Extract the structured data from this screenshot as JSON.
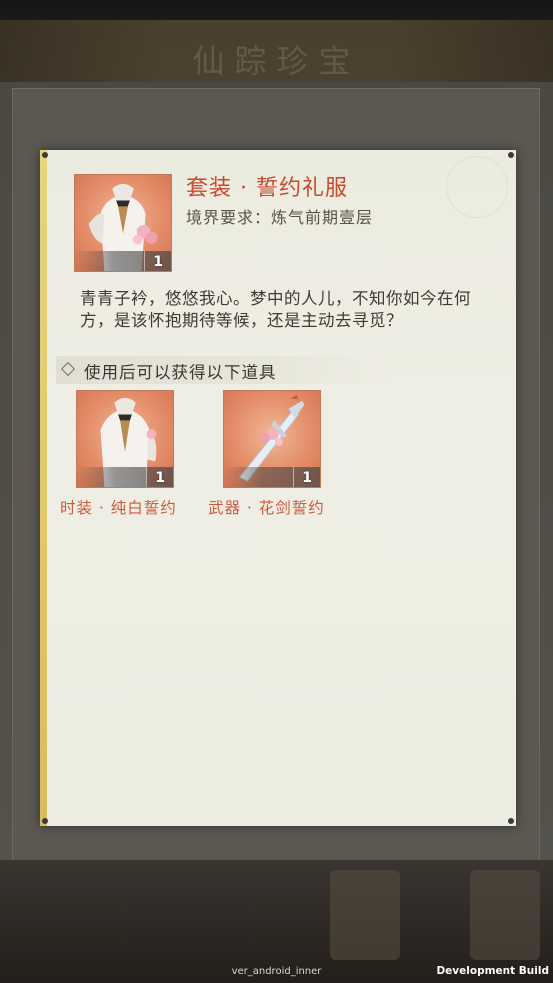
{
  "background": {
    "title": "仙踪珍宝"
  },
  "item": {
    "title": "套装 · 誓约礼服",
    "requirement": "境界要求：炼气前期壹层",
    "count": "1",
    "icon": "white-suit-outfit-icon",
    "description": "青青子衿，悠悠我心。梦中的人儿，不知你如今在何方，是该怀抱期待等候，还是主动去寻觅？"
  },
  "rewards_section": {
    "label": "使用后可以获得以下道具"
  },
  "rewards": [
    {
      "name": "时装 · 纯白誓约",
      "count": "1",
      "icon": "white-suit-outfit-icon"
    },
    {
      "name": "武器 · 花剑誓约",
      "count": "1",
      "icon": "flower-sword-icon"
    }
  ],
  "footer": {
    "build_label": "ver_android_inner",
    "dev_label": "Development Build"
  },
  "colors": {
    "title": "#c84a2c",
    "reward_name": "#d05a3c",
    "card": "#eeede3",
    "spine": "#e0c86a",
    "icon_bg": "#e48d68"
  }
}
